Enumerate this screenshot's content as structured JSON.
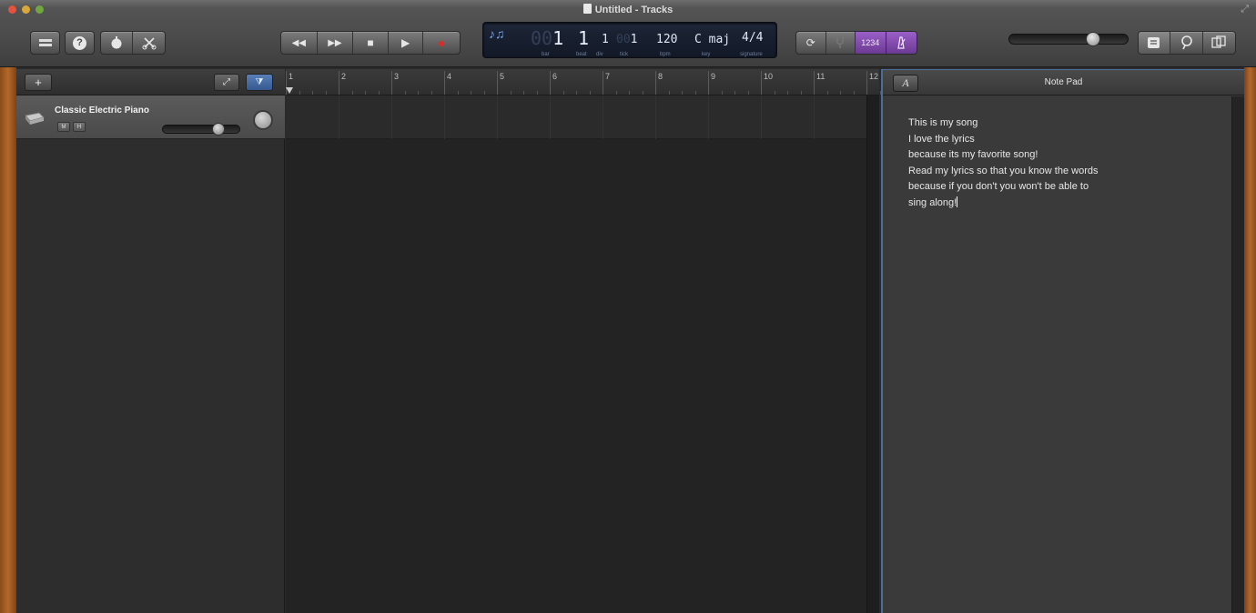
{
  "window": {
    "title": "Untitled - Tracks"
  },
  "toolbar": {
    "library_icon": "library-icon",
    "help_label": "?",
    "smart_controls_icon": "smart-controls-icon",
    "editors_icon": "scissors-icon",
    "rewind_label": "◀◀",
    "forward_label": "▶▶",
    "stop_label": "■",
    "play_label": "▶",
    "record_label": "●",
    "cycle_label": "⟳",
    "count_in_label": "1234",
    "metronome_label": "♪"
  },
  "lcd": {
    "bar_dim": "00",
    "bar": "1",
    "beat": "1",
    "div": "1",
    "tick_dim": "00",
    "tick": "1",
    "bpm": "120",
    "key": "C maj",
    "signature": "4/4",
    "labels": {
      "bar": "bar",
      "beat": "beat",
      "div": "div",
      "tick": "tick",
      "bpm": "bpm",
      "key": "key",
      "signature": "signature"
    }
  },
  "master_volume": {
    "level": 0.72
  },
  "track_header": {
    "add_label": "+",
    "catch_label": "⤢",
    "filter_label": "⧩"
  },
  "tracks": [
    {
      "name": "Classic Electric Piano",
      "mute_label": "M",
      "solo_label": "H",
      "volume": 0.72
    }
  ],
  "ruler": {
    "bars": [
      "1",
      "2",
      "3",
      "4",
      "5",
      "6",
      "7",
      "8",
      "9",
      "10",
      "11",
      "12"
    ]
  },
  "notepad": {
    "title": "Note Pad",
    "font_label": "A",
    "lines": [
      "This is my song",
      "I love the lyrics",
      "because its my favorite song!",
      "Read my lyrics so that you know the words",
      "because if you don't you won't be able to",
      "sing along!"
    ]
  },
  "colors": {
    "accent_purple": "#7a44a8",
    "lcd_bg": "#161d2c",
    "wood": "#b4692a"
  }
}
